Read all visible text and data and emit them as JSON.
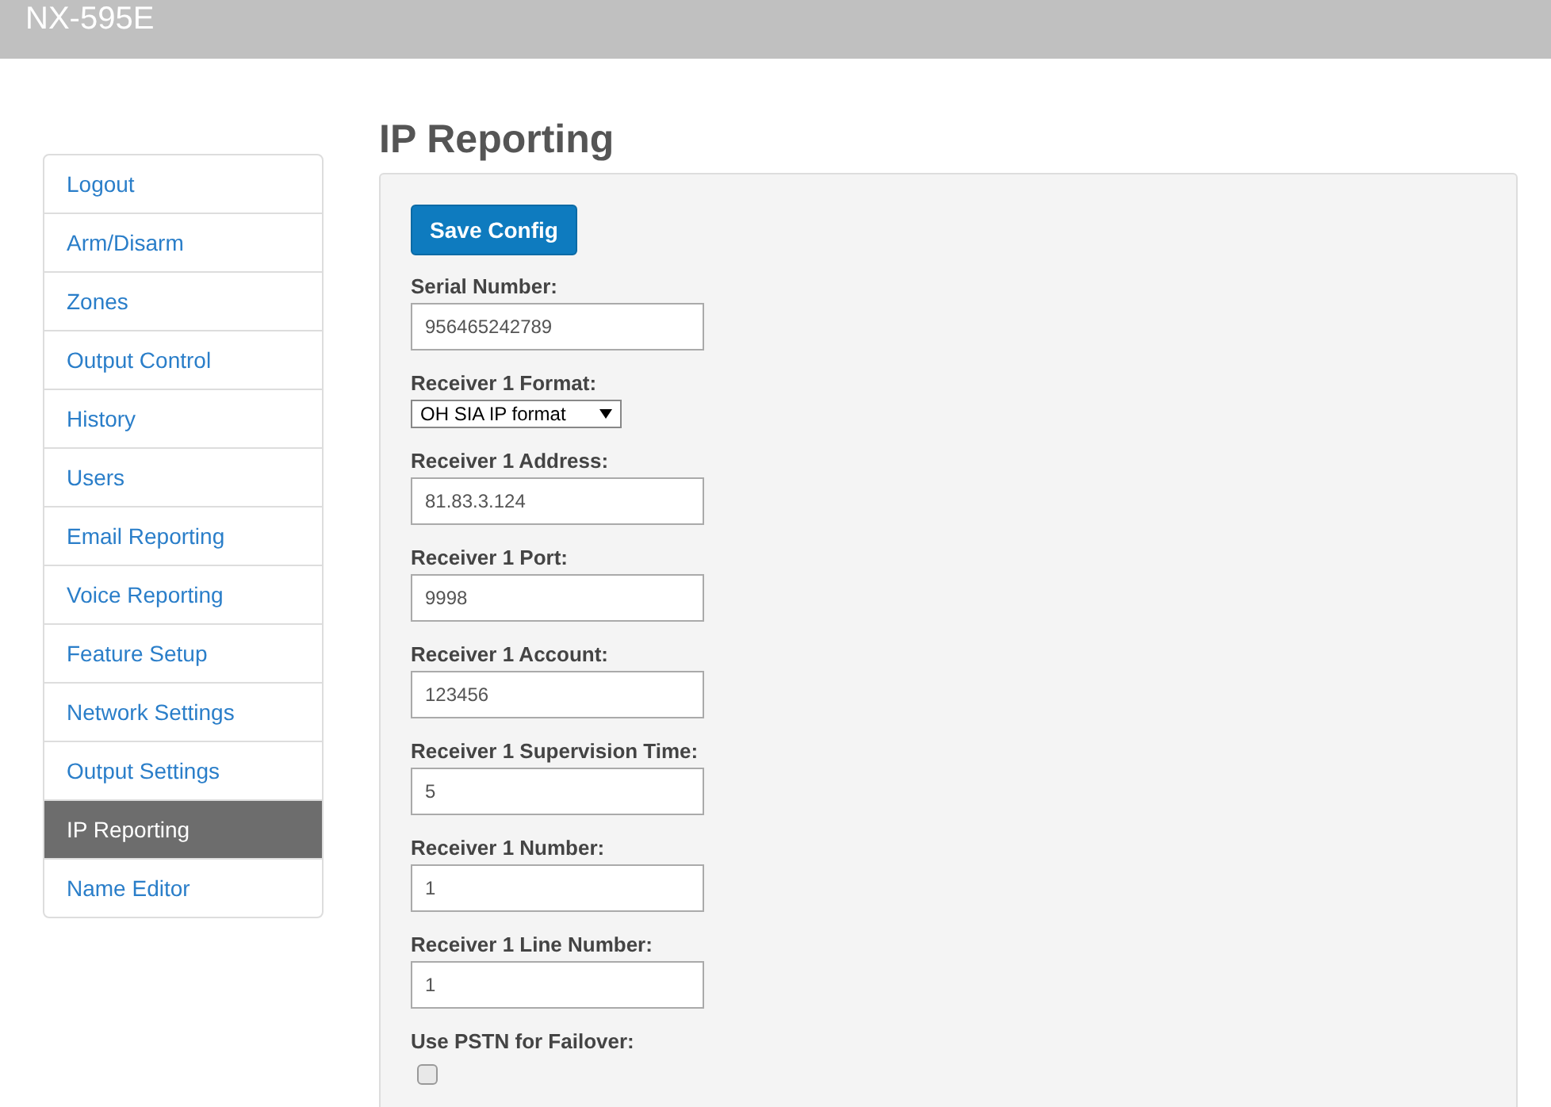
{
  "header": {
    "title": "NX-595E"
  },
  "sidebar": {
    "items": [
      {
        "label": "Logout",
        "selected": false
      },
      {
        "label": "Arm/Disarm",
        "selected": false
      },
      {
        "label": "Zones",
        "selected": false
      },
      {
        "label": "Output Control",
        "selected": false
      },
      {
        "label": "History",
        "selected": false
      },
      {
        "label": "Users",
        "selected": false
      },
      {
        "label": "Email Reporting",
        "selected": false
      },
      {
        "label": "Voice Reporting",
        "selected": false
      },
      {
        "label": "Feature Setup",
        "selected": false
      },
      {
        "label": "Network Settings",
        "selected": false
      },
      {
        "label": "Output Settings",
        "selected": false
      },
      {
        "label": "IP Reporting",
        "selected": true
      },
      {
        "label": "Name Editor",
        "selected": false
      }
    ]
  },
  "page": {
    "title": "IP Reporting",
    "save_button": "Save Config",
    "fields": [
      {
        "kind": "text",
        "label": "Serial Number:",
        "value": "956465242789"
      },
      {
        "kind": "select",
        "label": "Receiver 1 Format:",
        "value": "OH SIA IP format"
      },
      {
        "kind": "text",
        "label": "Receiver 1 Address:",
        "value": "81.83.3.124"
      },
      {
        "kind": "text",
        "label": "Receiver 1 Port:",
        "value": "9998"
      },
      {
        "kind": "text",
        "label": "Receiver 1 Account:",
        "value": "123456"
      },
      {
        "kind": "text",
        "label": "Receiver 1 Supervision Time:",
        "value": "5"
      },
      {
        "kind": "text",
        "label": "Receiver 1 Number:",
        "value": "1"
      },
      {
        "kind": "text",
        "label": "Receiver 1 Line Number:",
        "value": "1"
      },
      {
        "kind": "checkbox",
        "label": "Use PSTN for Failover:",
        "checked": false
      }
    ]
  }
}
